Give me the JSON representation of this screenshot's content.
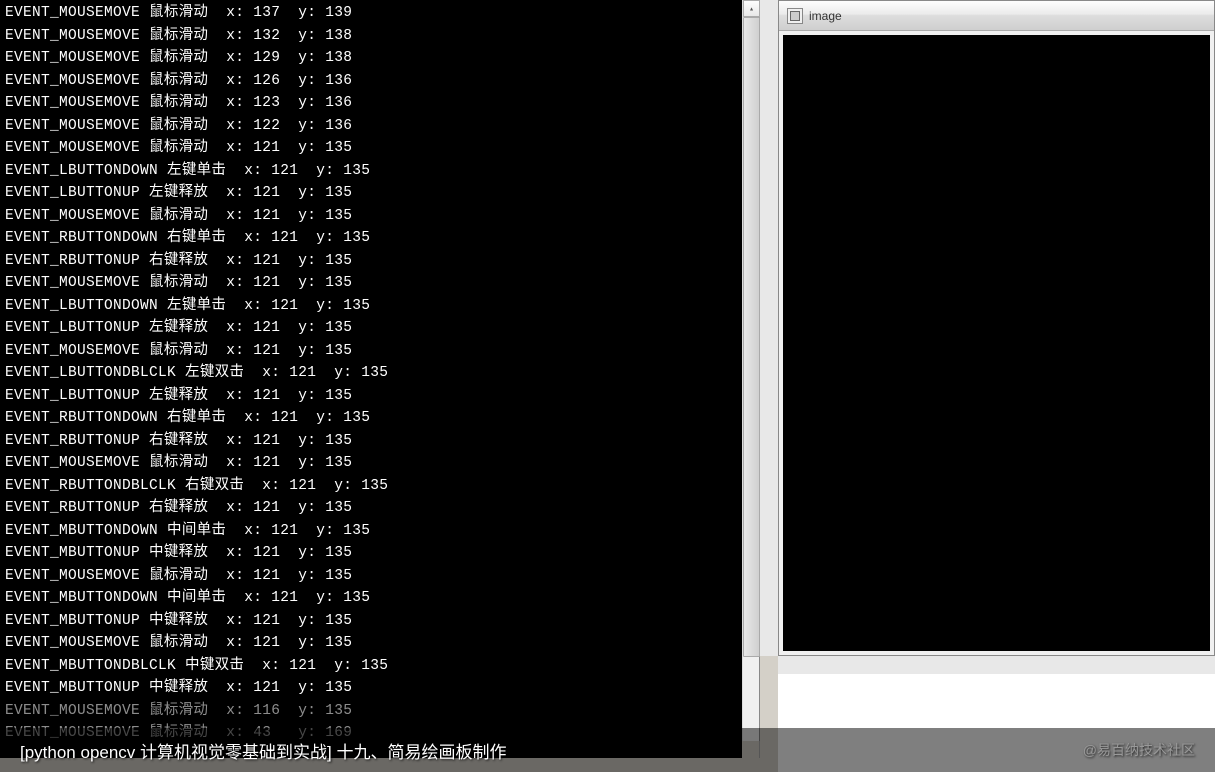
{
  "console": {
    "lines": [
      "EVENT_MOUSEMOVE 鼠标滑动  x: 137  y: 139",
      "EVENT_MOUSEMOVE 鼠标滑动  x: 132  y: 138",
      "EVENT_MOUSEMOVE 鼠标滑动  x: 129  y: 138",
      "EVENT_MOUSEMOVE 鼠标滑动  x: 126  y: 136",
      "EVENT_MOUSEMOVE 鼠标滑动  x: 123  y: 136",
      "EVENT_MOUSEMOVE 鼠标滑动  x: 122  y: 136",
      "EVENT_MOUSEMOVE 鼠标滑动  x: 121  y: 135",
      "EVENT_LBUTTONDOWN 左键单击  x: 121  y: 135",
      "EVENT_LBUTTONUP 左键释放  x: 121  y: 135",
      "EVENT_MOUSEMOVE 鼠标滑动  x: 121  y: 135",
      "EVENT_RBUTTONDOWN 右键单击  x: 121  y: 135",
      "EVENT_RBUTTONUP 右键释放  x: 121  y: 135",
      "EVENT_MOUSEMOVE 鼠标滑动  x: 121  y: 135",
      "EVENT_LBUTTONDOWN 左键单击  x: 121  y: 135",
      "EVENT_LBUTTONUP 左键释放  x: 121  y: 135",
      "EVENT_MOUSEMOVE 鼠标滑动  x: 121  y: 135",
      "EVENT_LBUTTONDBLCLK 左键双击  x: 121  y: 135",
      "EVENT_LBUTTONUP 左键释放  x: 121  y: 135",
      "EVENT_RBUTTONDOWN 右键单击  x: 121  y: 135",
      "EVENT_RBUTTONUP 右键释放  x: 121  y: 135",
      "EVENT_MOUSEMOVE 鼠标滑动  x: 121  y: 135",
      "EVENT_RBUTTONDBLCLK 右键双击  x: 121  y: 135",
      "EVENT_RBUTTONUP 右键释放  x: 121  y: 135",
      "EVENT_MBUTTONDOWN 中间单击  x: 121  y: 135",
      "EVENT_MBUTTONUP 中键释放  x: 121  y: 135",
      "EVENT_MOUSEMOVE 鼠标滑动  x: 121  y: 135",
      "EVENT_MBUTTONDOWN 中间单击  x: 121  y: 135",
      "EVENT_MBUTTONUP 中键释放  x: 121  y: 135",
      "EVENT_MOUSEMOVE 鼠标滑动  x: 121  y: 135",
      "EVENT_MBUTTONDBLCLK 中键双击  x: 121  y: 135",
      "EVENT_MBUTTONUP 中键释放  x: 121  y: 135"
    ],
    "faded_lines": [
      "EVENT_MOUSEMOVE 鼠标滑动  x: 116  y: 135",
      "EVENT_MOUSEMOVE 鼠标滑动  x: 43   y: 169"
    ]
  },
  "image_window": {
    "title": "image"
  },
  "caption": {
    "text": "[python opencv 计算机视觉零基础到实战]  十九、简易绘画板制作",
    "watermark": "@易百纳技术社区"
  }
}
